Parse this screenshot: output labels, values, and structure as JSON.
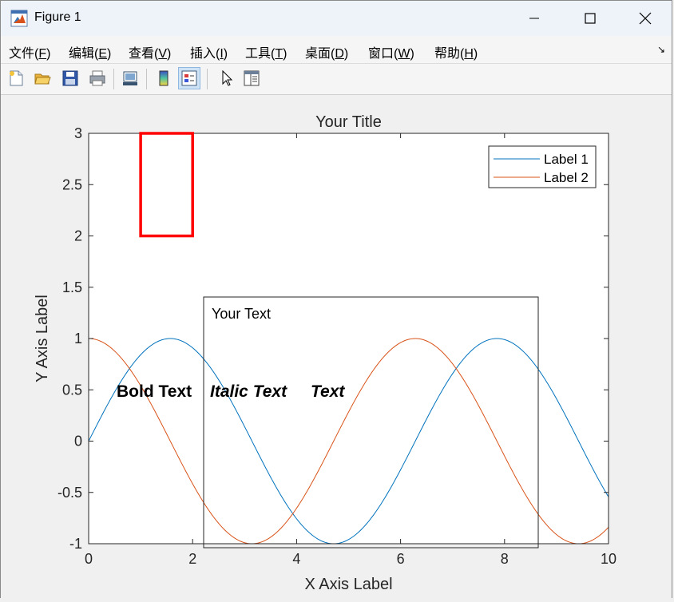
{
  "window": {
    "title": "Figure 1",
    "controls": {
      "minimize": "minimize",
      "maximize": "maximize",
      "close": "close"
    }
  },
  "menu": [
    {
      "label": "文件(",
      "key": "F",
      "end": ")"
    },
    {
      "label": "编辑(",
      "key": "E",
      "end": ")"
    },
    {
      "label": "查看(",
      "key": "V",
      "end": ")"
    },
    {
      "label": "插入(",
      "key": "I",
      "end": ")"
    },
    {
      "label": "工具(",
      "key": "T",
      "end": ")"
    },
    {
      "label": "桌面(",
      "key": "D",
      "end": ")"
    },
    {
      "label": "窗口(",
      "key": "W",
      "end": ")"
    },
    {
      "label": "帮助(",
      "key": "H",
      "end": ")"
    }
  ],
  "toolbar": [
    "new-figure-icon",
    "open-file-icon",
    "save-icon",
    "print-icon",
    "link-plot-icon",
    "colorbar-icon",
    "legend-icon",
    "pointer-icon",
    "property-editor-icon"
  ],
  "chart_data": {
    "type": "line",
    "title": "Your Title",
    "xlabel": "X Axis Label",
    "ylabel": "Y Axis Label",
    "xlim": [
      0,
      10
    ],
    "ylim": [
      -1,
      3
    ],
    "xticks": [
      "0",
      "2",
      "4",
      "6",
      "8",
      "10"
    ],
    "yticks": [
      "-1",
      "-0.5",
      "0",
      "0.5",
      "1",
      "1.5",
      "2",
      "2.5",
      "3"
    ],
    "grid": false,
    "legend_position": "top-right",
    "series": [
      {
        "name": "Label 1",
        "function": "sin(x)",
        "color": "#0072bd"
      },
      {
        "name": "Label 2",
        "function": "cos(x)",
        "color": "#d95319"
      }
    ],
    "annotations": {
      "rectangle": {
        "x": 1,
        "y": 2,
        "width": 1,
        "height": 1,
        "color": "#ff0000"
      },
      "textbox": "Your Text",
      "bold_text": "Bold Text",
      "italic_text": "Italic Text",
      "bold_italic_text": "Text"
    }
  }
}
